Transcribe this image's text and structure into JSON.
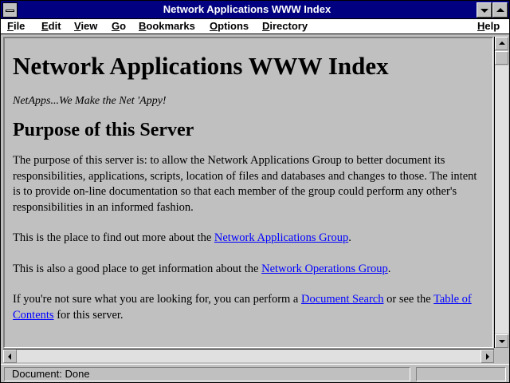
{
  "window": {
    "title": "Network Applications WWW Index"
  },
  "menubar": {
    "items": [
      {
        "label": "File"
      },
      {
        "label": "Edit"
      },
      {
        "label": "View"
      },
      {
        "label": "Go"
      },
      {
        "label": "Bookmarks"
      },
      {
        "label": "Options"
      },
      {
        "label": "Directory"
      },
      {
        "label": "Help"
      }
    ]
  },
  "page": {
    "heading": "Network Applications WWW Index",
    "tagline": "NetApps...We Make the Net 'Appy!",
    "section_title": "Purpose of this Server",
    "paragraph1": "The purpose of this server is: to allow the Network Applications Group to better document its responsibilities, applications, scripts, location of files and databases and changes to those. The intent is to provide on-line documentation so that each member of the group could perform any other's responsibilities in an informed fashion.",
    "p2_before": "This is the place to find out more about the ",
    "p2_link": "Network Applications Group",
    "p2_after": ".",
    "p3_before": "This is also a good place to get information about the ",
    "p3_link": "Network Operations Group",
    "p3_after": ".",
    "p4_before": "If you're not sure what you are looking for, you can perform a ",
    "p4_link1": "Document Search",
    "p4_middle": " or see the ",
    "p4_link2": "Table of Contents",
    "p4_after": " for this server."
  },
  "status": {
    "text": "Document: Done",
    "progress_fraction": 0
  },
  "colors": {
    "titlebar": "#000080",
    "link": "#0000ff",
    "window_bg": "#c0c0c0"
  }
}
